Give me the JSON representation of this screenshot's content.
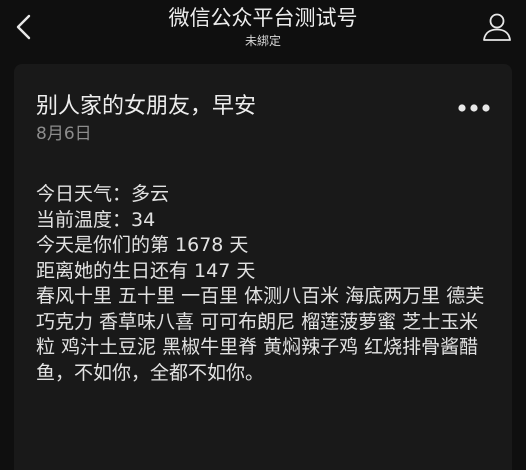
{
  "nav": {
    "title": "微信公众平台测试号",
    "subtitle": "未綁定",
    "back_icon": "chevron-left-icon",
    "profile_icon": "person-icon"
  },
  "message": {
    "title": "别人家的女朋友，早安",
    "date": "8月6日",
    "more_icon": "more-dots-icon",
    "lines": [
      "今日天气：多云",
      "当前温度：34",
      "今天是你们的第 1678 天",
      "距离她的生日还有 147 天"
    ],
    "poem": "春风十里 五十里 一百里 体测八百米 海底两万里 德芙巧克力 香草味八喜 可可布朗尼 榴莲菠萝蜜 芝士玉米粒 鸡汁土豆泥 黑椒牛里脊 黄焖辣子鸡 红烧排骨酱醋鱼，不如你，全都不如你。"
  },
  "colors": {
    "background": "#0f0f0f",
    "card": "#191919",
    "text_primary": "#ededed",
    "text_secondary": "#8d8d8d"
  }
}
